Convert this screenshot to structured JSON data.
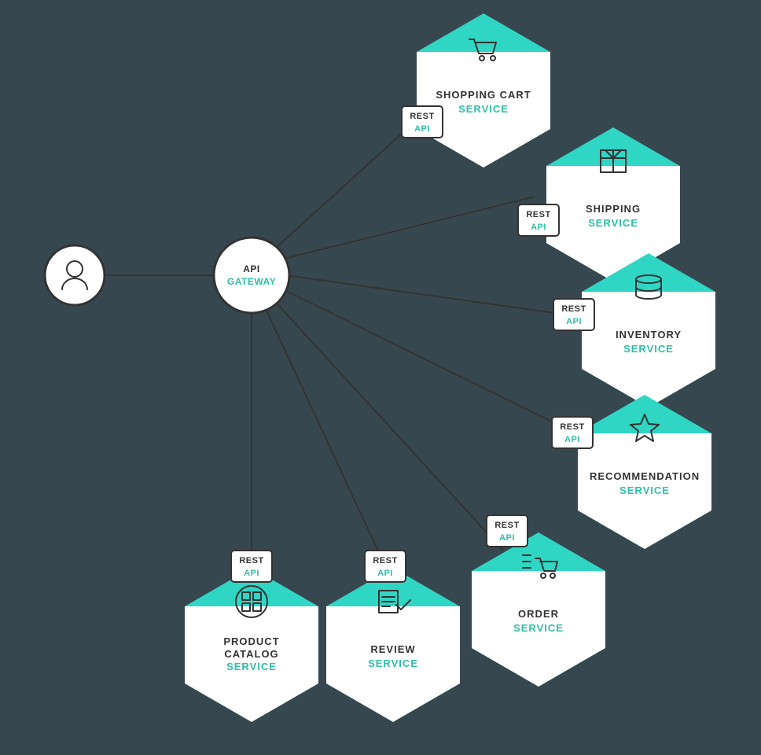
{
  "user_node": {
    "icon": "user"
  },
  "gateway": {
    "line1": "API",
    "line2": "GATEWAY"
  },
  "badge": {
    "line1": "REST",
    "line2": "API"
  },
  "services": {
    "shopping_cart": {
      "line1": "SHOPPING CART",
      "line2": "SERVICE",
      "icon": "cart"
    },
    "shipping": {
      "line1": "SHIPPING",
      "line2": "SERVICE",
      "icon": "box"
    },
    "inventory": {
      "line1": "INVENTORY",
      "line2": "SERVICE",
      "icon": "stack"
    },
    "recommendation": {
      "line1": "RECOMMENDATION",
      "line2": "SERVICE",
      "icon": "star"
    },
    "order": {
      "line1": "ORDER",
      "line2": "SERVICE",
      "icon": "list-cart"
    },
    "review": {
      "line1": "REVIEW",
      "line2": "SERVICE",
      "icon": "review"
    },
    "product_catalog": {
      "line1": "PRODUCT",
      "line2": "CATALOG",
      "line3": "SERVICE",
      "icon": "grid"
    }
  }
}
